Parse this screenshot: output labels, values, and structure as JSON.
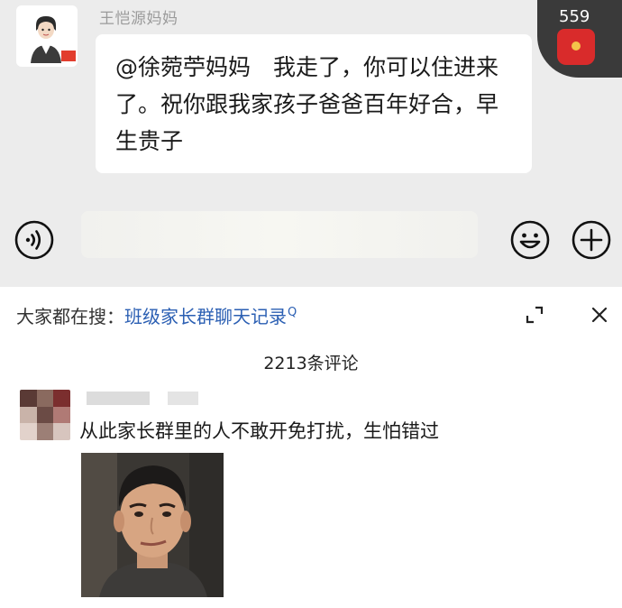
{
  "chat": {
    "sender_name": "王恺源妈妈",
    "message": "@徐菀苧妈妈　我走了，你可以住进来了。祝你跟我家孩子爸爸百年好合，早生贵子",
    "red_packet_count": "559",
    "icons": {
      "voice": "voice-icon",
      "emoji": "emoji-icon",
      "plus": "plus-icon",
      "red_packet": "red-packet-icon"
    }
  },
  "search": {
    "prefix": "大家都在搜：",
    "query": "班级家长群聊天记录",
    "search_icon": "Q"
  },
  "comments": {
    "count_label": "2213条评论",
    "items": [
      {
        "text": "从此家长群里的人不敢开免打扰，生怕错过",
        "image": "man-portrait-meme"
      }
    ]
  },
  "colors": {
    "chat_bg": "#ececec",
    "link": "#2b5fb3",
    "red_packet": "#d92b2b",
    "text": "#1a1a1a"
  }
}
